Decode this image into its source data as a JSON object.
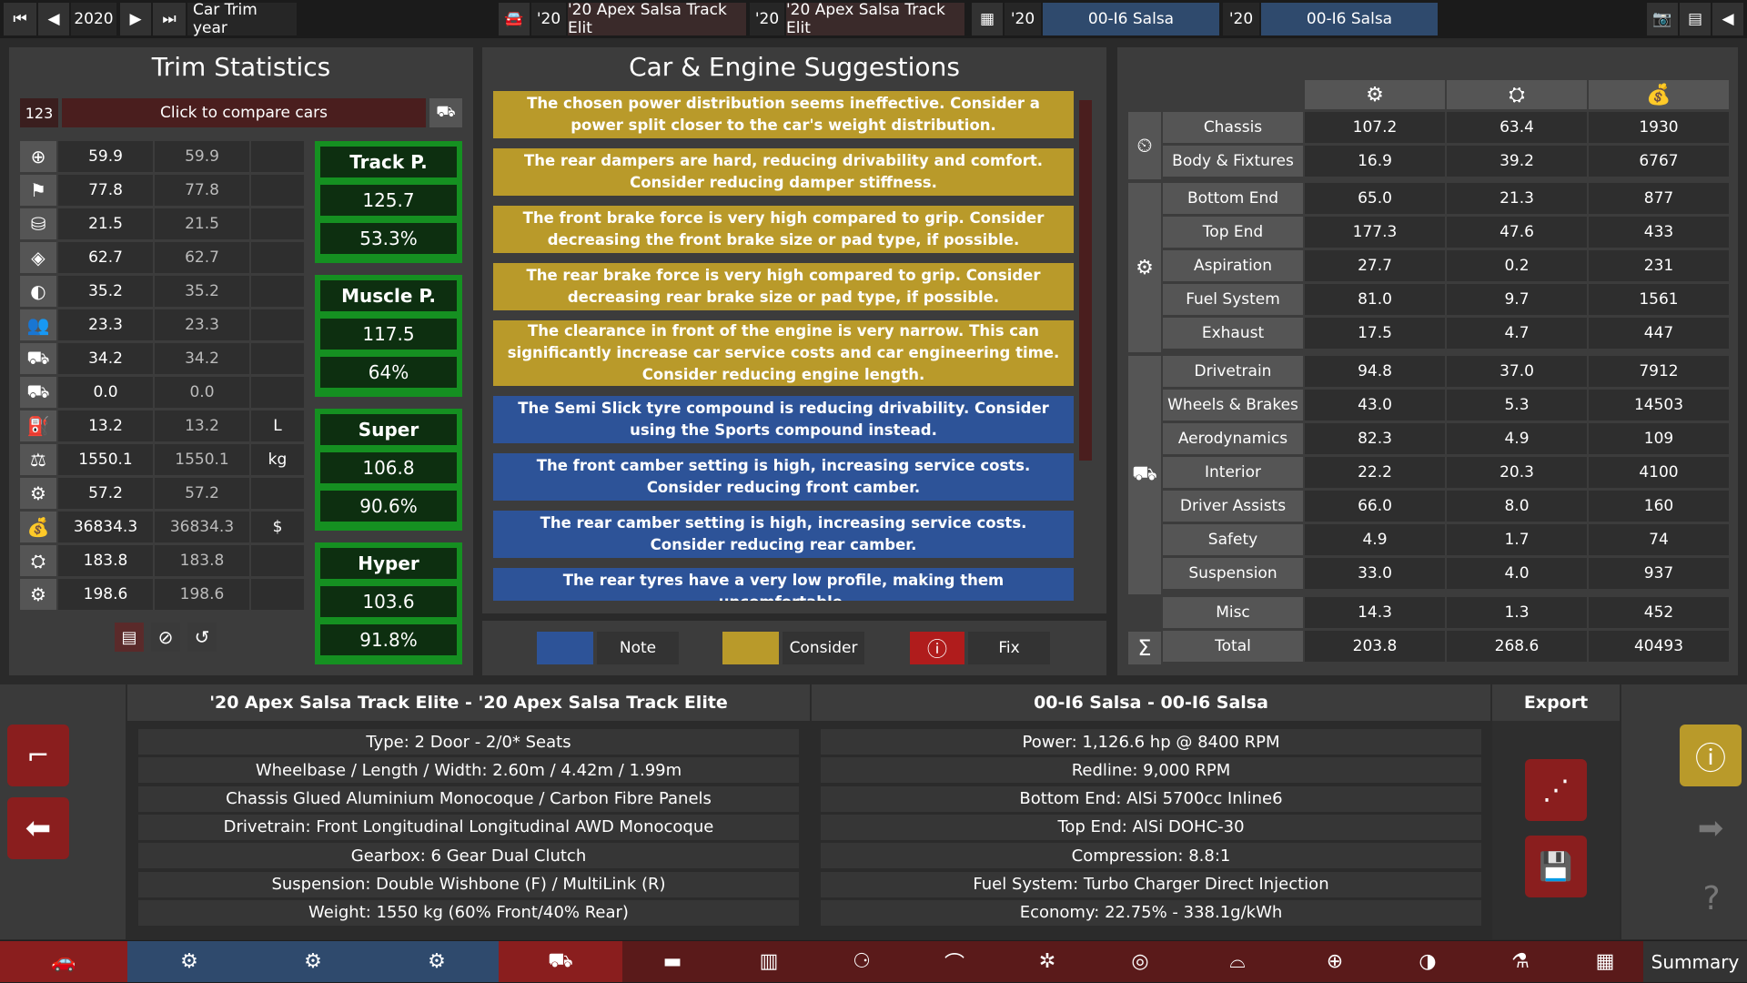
{
  "topbar": {
    "year": "2020",
    "year_label": "Car Trim year",
    "car1_year": "'20",
    "car1_name": "'20 Apex Salsa Track Elit",
    "car2_year": "'20",
    "car2_name": "'20 Apex Salsa Track Elit",
    "eng1_year": "'20",
    "eng1_name": "00-I6 Salsa",
    "eng2_year": "'20",
    "eng2_name": "00-I6 Salsa"
  },
  "trim": {
    "title": "Trim Statistics",
    "compare_num": "123",
    "compare_label": "Click to compare cars",
    "rows": [
      {
        "icon": "steering-wheel-icon",
        "a": "59.9",
        "b": "59.9",
        "u": ""
      },
      {
        "icon": "race-flag-icon",
        "a": "77.8",
        "b": "77.8",
        "u": ""
      },
      {
        "icon": "seat-icon",
        "a": "21.5",
        "b": "21.5",
        "u": ""
      },
      {
        "icon": "shield-icon",
        "a": "62.7",
        "b": "62.7",
        "u": ""
      },
      {
        "icon": "tire-icon",
        "a": "35.2",
        "b": "35.2",
        "u": ""
      },
      {
        "icon": "people-icon",
        "a": "23.3",
        "b": "23.3",
        "u": ""
      },
      {
        "icon": "car-cargo-icon",
        "a": "34.2",
        "b": "34.2",
        "u": ""
      },
      {
        "icon": "offroad-car-icon",
        "a": "0.0",
        "b": "0.0",
        "u": ""
      },
      {
        "icon": "fuel-can-icon",
        "a": "13.2",
        "b": "13.2",
        "u": "L"
      },
      {
        "icon": "weight-icon",
        "a": "1550.1",
        "b": "1550.1",
        "u": "kg"
      },
      {
        "icon": "brain-gear-icon",
        "a": "57.2",
        "b": "57.2",
        "u": ""
      },
      {
        "icon": "money-bag-icon",
        "a": "36834.3",
        "b": "36834.3",
        "u": "$"
      },
      {
        "icon": "tools-cost-icon",
        "a": "183.8",
        "b": "183.8",
        "u": ""
      },
      {
        "icon": "gear-wrench-icon",
        "a": "198.6",
        "b": "198.6",
        "u": ""
      }
    ],
    "markets": [
      {
        "name": "Track P.",
        "v1": "125.7",
        "v2": "53.3%"
      },
      {
        "name": "Muscle P.",
        "v1": "117.5",
        "v2": "64%"
      },
      {
        "name": "Super",
        "v1": "106.8",
        "v2": "90.6%"
      },
      {
        "name": "Hyper",
        "v1": "103.6",
        "v2": "91.8%"
      }
    ]
  },
  "suggest": {
    "title": "Car & Engine Suggestions",
    "items": [
      {
        "kind": "y",
        "text": "The chosen power distribution seems ineffective. Consider a power split closer to the car's weight distribution."
      },
      {
        "kind": "y",
        "text": "The rear dampers are hard, reducing drivability and comfort. Consider reducing damper stiffness."
      },
      {
        "kind": "y",
        "text": "The front brake force is very high compared to grip. Consider decreasing the front brake size or pad type, if possible."
      },
      {
        "kind": "y",
        "text": "The rear brake force is very high compared to grip. Consider decreasing rear brake size or pad type, if possible."
      },
      {
        "kind": "y",
        "text": "The clearance in front of the engine is very narrow. This can significantly increase car service costs and car engineering time. Consider reducing engine length."
      },
      {
        "kind": "b",
        "text": "The Semi Slick tyre compound is reducing drivability. Consider using the Sports compound instead."
      },
      {
        "kind": "b",
        "text": "The front camber setting is high, increasing service costs. Consider reducing front camber."
      },
      {
        "kind": "b",
        "text": "The rear camber setting is high, increasing service costs. Consider reducing rear camber."
      },
      {
        "kind": "b",
        "text": "The rear tyres have a very low profile, making them uncomfortable."
      }
    ],
    "legend": {
      "note": "Note",
      "consider": "Consider",
      "fix": "Fix"
    }
  },
  "costs": {
    "rows": [
      {
        "name": "Chassis",
        "a": "107.2",
        "b": "63.4",
        "c": "1930"
      },
      {
        "name": "Body & Fixtures",
        "a": "16.9",
        "b": "39.2",
        "c": "6767"
      },
      {
        "name": "Bottom End",
        "a": "65.0",
        "b": "21.3",
        "c": "877"
      },
      {
        "name": "Top End",
        "a": "177.3",
        "b": "47.6",
        "c": "433"
      },
      {
        "name": "Aspiration",
        "a": "27.7",
        "b": "0.2",
        "c": "231"
      },
      {
        "name": "Fuel System",
        "a": "81.0",
        "b": "9.7",
        "c": "1561"
      },
      {
        "name": "Exhaust",
        "a": "17.5",
        "b": "4.7",
        "c": "447"
      },
      {
        "name": "Drivetrain",
        "a": "94.8",
        "b": "37.0",
        "c": "7912"
      },
      {
        "name": "Wheels & Brakes",
        "a": "43.0",
        "b": "5.3",
        "c": "14503"
      },
      {
        "name": "Aerodynamics",
        "a": "82.3",
        "b": "4.9",
        "c": "109"
      },
      {
        "name": "Interior",
        "a": "22.2",
        "b": "20.3",
        "c": "4100"
      },
      {
        "name": "Driver Assists",
        "a": "66.0",
        "b": "8.0",
        "c": "160"
      },
      {
        "name": "Safety",
        "a": "4.9",
        "b": "1.7",
        "c": "74"
      },
      {
        "name": "Suspension",
        "a": "33.0",
        "b": "4.0",
        "c": "937"
      },
      {
        "name": "Misc",
        "a": "14.3",
        "b": "1.3",
        "c": "452"
      },
      {
        "name": "Total",
        "a": "203.8",
        "b": "268.6",
        "c": "40493"
      }
    ],
    "sum_symbol": "Σ"
  },
  "car_info": {
    "title": "'20 Apex Salsa Track Elite - '20 Apex Salsa Track Elite",
    "lines": [
      "Type: 2 Door - 2/0* Seats",
      "Wheelbase / Length / Width: 2.60m / 4.42m / 1.99m",
      "Chassis Glued Aluminium Monocoque / Carbon Fibre Panels",
      "Drivetrain: Front Longitudinal Longitudinal AWD Monocoque",
      "Gearbox: 6 Gear Dual Clutch",
      "Suspension: Double Wishbone (F) / MultiLink (R)",
      "Weight: 1550 kg (60% Front/40% Rear)"
    ]
  },
  "engine_info": {
    "title": "00-I6 Salsa - 00-I6 Salsa",
    "lines": [
      "Power: 1,126.6 hp @ 8400 RPM",
      "Redline:  9,000 RPM",
      "Bottom End: AlSi 5700cc Inline6",
      "Top End: AlSi DOHC-30",
      "Compression: 8.8:1",
      "Fuel System: Turbo Charger Direct Injection",
      "Economy: 22.75% - 338.1g/kWh"
    ]
  },
  "export": {
    "title": "Export"
  },
  "bottom": {
    "summary": "Summary"
  },
  "colors": {
    "note": "#2d5398",
    "consider": "#b99a2a",
    "fix": "#b01c1c",
    "green": "#159021"
  }
}
